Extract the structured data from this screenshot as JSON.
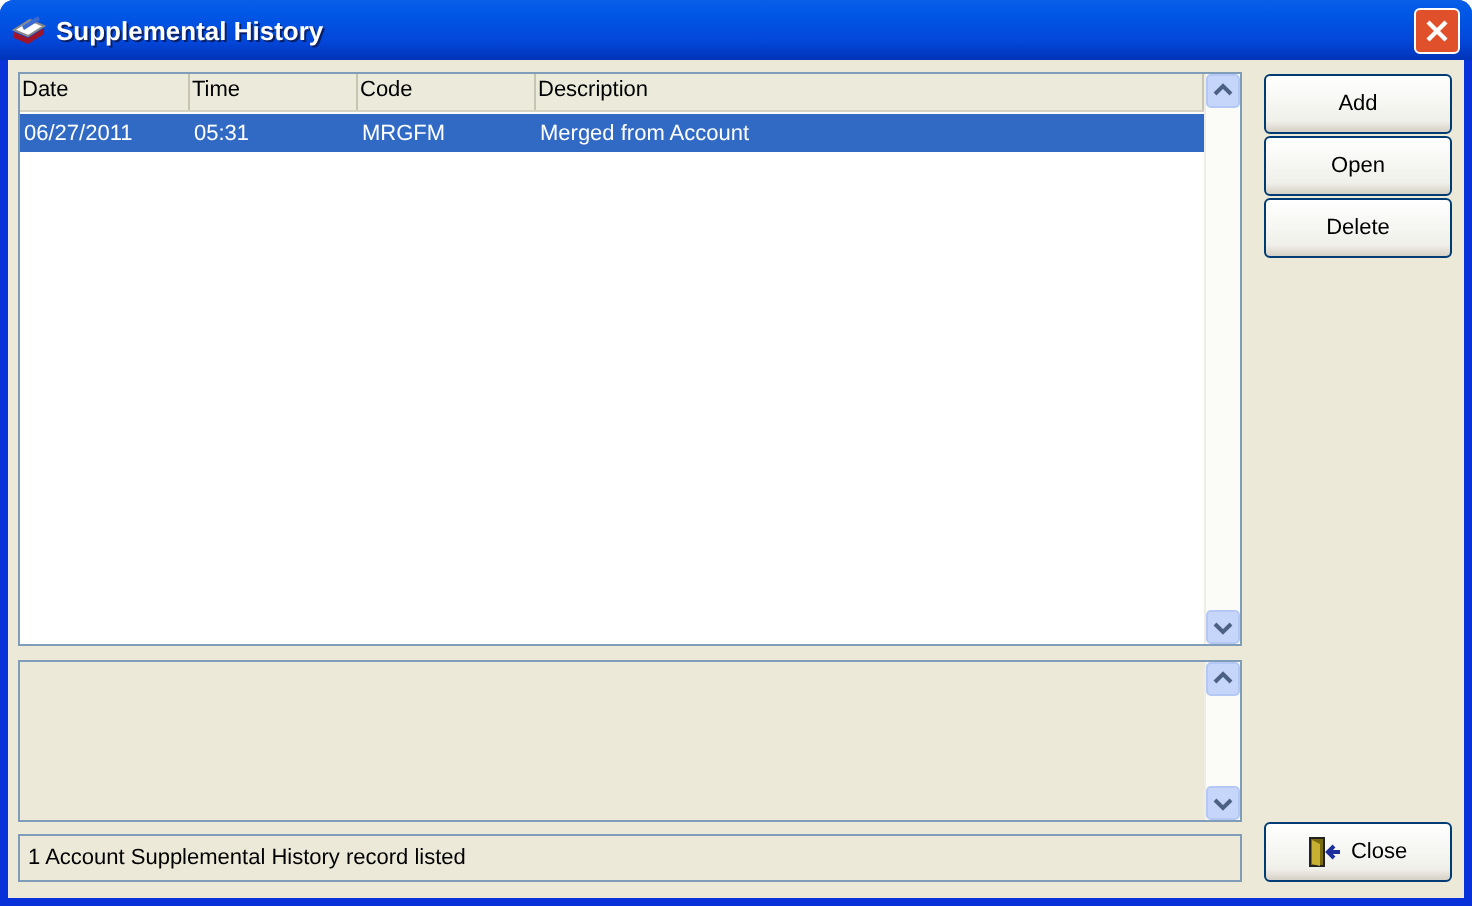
{
  "window": {
    "title": "Supplemental History"
  },
  "table": {
    "columns": [
      "Date",
      "Time",
      "Code",
      "Description"
    ],
    "rows": [
      {
        "cells": [
          "06/27/2011",
          "05:31",
          "MRGFM",
          "Merged from Account"
        ],
        "selected": true
      }
    ]
  },
  "buttons": [
    {
      "label": "Add"
    },
    {
      "label": "Open"
    },
    {
      "label": "Delete"
    }
  ],
  "status_bar": "1 Account Supplemental History record listed",
  "close_button": {
    "label": "Close"
  }
}
